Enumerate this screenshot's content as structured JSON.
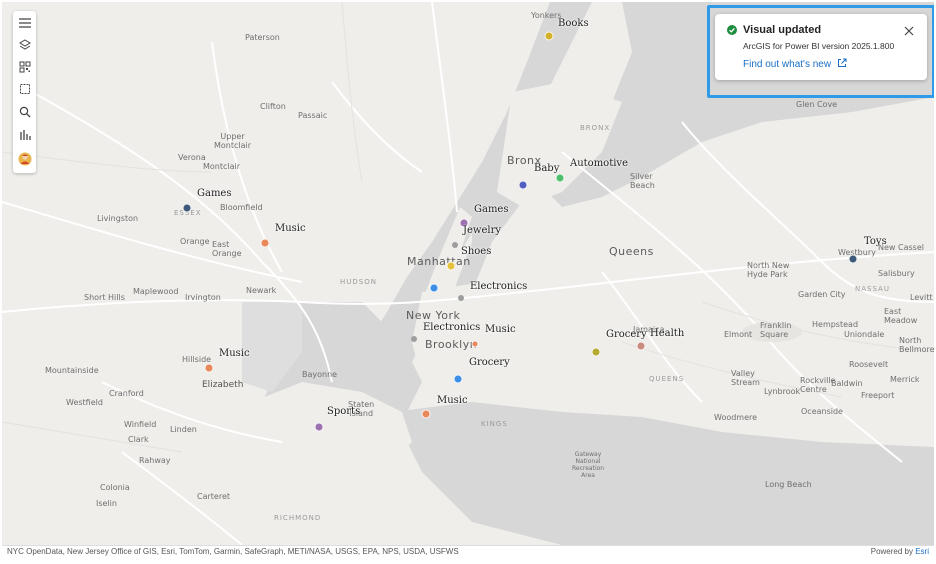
{
  "notification": {
    "title": "Visual updated",
    "subtitle": "ArcGIS for Power BI version 2025.1.800",
    "link": "Find out what's new",
    "status_color": "#1e8e3e"
  },
  "toolbar": {
    "buttons": [
      "menu-icon",
      "layers-icon",
      "qr-icon",
      "select-icon",
      "search-icon",
      "chart-icon",
      "avatar-icon"
    ]
  },
  "footer": {
    "attribution": "NYC OpenData, New Jersey Office of GIS, Esri, TomTom, Garmin, SafeGraph, METI/NASA, USGS, EPA, NPS, USDA, USFWS",
    "powered_by": "Powered by",
    "powered_link": "Esri"
  },
  "places": {
    "paterson": "Paterson",
    "clifton": "Clifton",
    "passaic": "Passaic",
    "upper_montclair": "Upper\nMontclair",
    "verona": "Verona",
    "montclair": "Montclair",
    "livingston": "Livingston",
    "essex": "ESSEX",
    "bloomfield": "Bloomfield",
    "orange": "Orange",
    "east_orange": "East\nOrange",
    "newark": "Newark",
    "short_hills": "Short Hills",
    "maplewood": "Maplewood",
    "irvington": "Irvington",
    "hudson": "HUDSON",
    "mountainside": "Mountainside",
    "elizabeth": "Elizabeth",
    "hillside": "Hillside",
    "westfield": "Westfield",
    "cranford": "Cranford",
    "winfield": "Winfield",
    "clark": "Clark",
    "linden": "Linden",
    "rahway": "Rahway",
    "colonia": "Colonia",
    "iselin": "Iselin",
    "carteret": "Carteret",
    "richmond": "RICHMOND",
    "bayonne": "Bayonne",
    "staten_island": "Staten\nIsland",
    "yonkers": "Yonkers",
    "bronx": "Bronx",
    "bronx_county": "BRONX",
    "silver_beach": "Silver\nBeach",
    "manhattan": "Manhattan",
    "new_york": "New York",
    "brooklyn": "Brooklyn",
    "kings": "KINGS",
    "queens": "Queens",
    "queens_county": "QUEENS",
    "jamaica": "Jamaica",
    "gateway": "Gateway\nNational\nRecreation\nArea",
    "glen_cove": "Glen Cove",
    "north_new_hyde_park": "North New\nHyde Park",
    "garden_city": "Garden City",
    "nassau": "NASSAU",
    "franklin_square": "Franklin\nSquare",
    "elmont": "Elmont",
    "hempstead": "Hempstead",
    "uniondale": "Uniondale",
    "westbury": "Westbury",
    "new_cassel": "New Cassel",
    "salisbury": "Salisbury",
    "east_meadow": "East\nMeadow",
    "levitt": "Levitt",
    "north_bellmore": "North\nBellmore",
    "roosevelt": "Roosevelt",
    "merrick": "Merrick",
    "valley_stream": "Valley\nStream",
    "lynbrook": "Lynbrook",
    "rockville_centre": "Rockville\nCentre",
    "baldwin": "Baldwin",
    "freeport": "Freeport",
    "oceanside": "Oceanside",
    "woodmere": "Woodmere",
    "long_beach": "Long Beach"
  },
  "markers": [
    {
      "label": "Books",
      "color": "#d4b128"
    },
    {
      "label": "Games",
      "color": "#3d5a7a"
    },
    {
      "label": "Music",
      "color": "#e8885a"
    },
    {
      "label": "Music",
      "color": "#e8885a"
    },
    {
      "label": "Baby",
      "color": "#4f5fc0"
    },
    {
      "label": "Automotive",
      "color": "#4fbf6e"
    },
    {
      "label": "Games",
      "color": "#9b6fb0"
    },
    {
      "label": "Jewelry",
      "color": "#9e9e9e"
    },
    {
      "label": "Shoes",
      "color": "#e4c23a"
    },
    {
      "label": "Electronics",
      "color": "#3e8ee8"
    },
    {
      "label": "Electronics",
      "color": "#9e9e9e"
    },
    {
      "label": "Music",
      "color": "#e8885a"
    },
    {
      "label": "Grocery",
      "color": "#3e8ee8"
    },
    {
      "label": "Sports",
      "color": "#9b6fb0"
    },
    {
      "label": "Music",
      "color": "#e8885a"
    },
    {
      "label": "Grocery",
      "color": "#b7aa32"
    },
    {
      "label": "Health",
      "color": "#c98a80"
    },
    {
      "label": "Toys",
      "color": "#3d5a7a"
    },
    {
      "label": "",
      "color": "#9e9e9e"
    }
  ]
}
